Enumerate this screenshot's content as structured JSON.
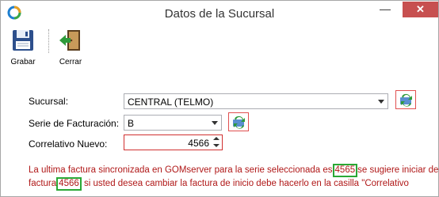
{
  "window": {
    "title": "Datos de la Sucursal",
    "minimize_glyph": "—",
    "close_glyph": "✕"
  },
  "toolbar": {
    "grabar_label": "Grabar",
    "cerrar_label": "Cerrar",
    "grabar_icon": "floppy-disk-icon",
    "cerrar_icon": "exit-door-icon"
  },
  "form": {
    "sucursal": {
      "label": "Sucursal:",
      "value": "CENTRAL (TELMO)"
    },
    "serie": {
      "label": "Serie de Facturación:",
      "value": "B"
    },
    "correlativo": {
      "label": "Correlativo Nuevo:",
      "value": "4566"
    }
  },
  "message": {
    "part1": "La ultima factura sincronizada en GOMserver para la serie seleccionada es",
    "last_number": "4565",
    "part2": "se sugiere iniciar de la",
    "part3": "factura",
    "suggested_number": "4566",
    "part4": " si usted desea cambiar la factura de inicio debe hacerlo en la casilla \"Correlativo"
  },
  "colors": {
    "message_text": "#b01818",
    "highlight_border": "#2aa835",
    "close_button": "#c75050"
  }
}
